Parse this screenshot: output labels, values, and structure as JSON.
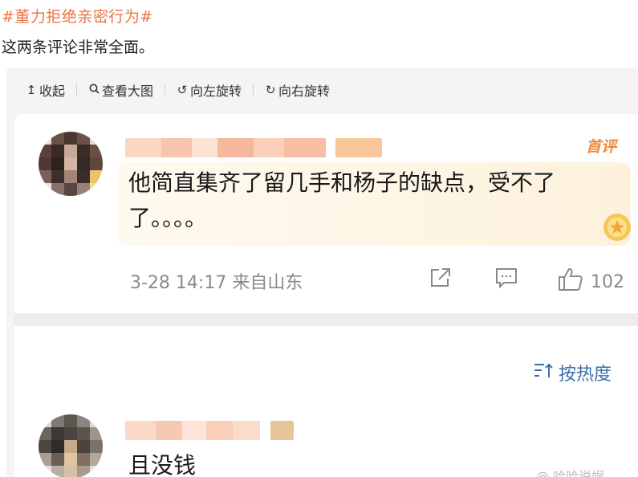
{
  "post": {
    "hashtag": "#董力拒绝亲密行为#",
    "text": "这两条评论非常全面。"
  },
  "toolbar": {
    "collapse_label": "收起",
    "view_large_label": "查看大图",
    "rotate_left_label": "向左旋转",
    "rotate_right_label": "向右旋转"
  },
  "comment1": {
    "badge": "首评",
    "text": "他简直集齐了留几手和杨子的缺点，受不了了。。。。",
    "meta": "3-28 14:17 来自山东",
    "likes": "102"
  },
  "sort": {
    "label": "按热度"
  },
  "comment2": {
    "text": "且没钱"
  },
  "watermark": "@ 哈哈说娱",
  "icons": {
    "collapse": "arrow-up-icon",
    "view_large": "magnifier-icon",
    "rotate_left": "rotate-left-icon",
    "rotate_right": "rotate-right-icon",
    "share": "share-icon",
    "reply": "comment-icon",
    "like": "thumbs-up-icon",
    "sort": "sort-icon"
  },
  "colors": {
    "hashtag": "#eb7340",
    "link": "#3d6fa5",
    "badge": "#f08a3a",
    "meta": "#8a8a8a"
  }
}
